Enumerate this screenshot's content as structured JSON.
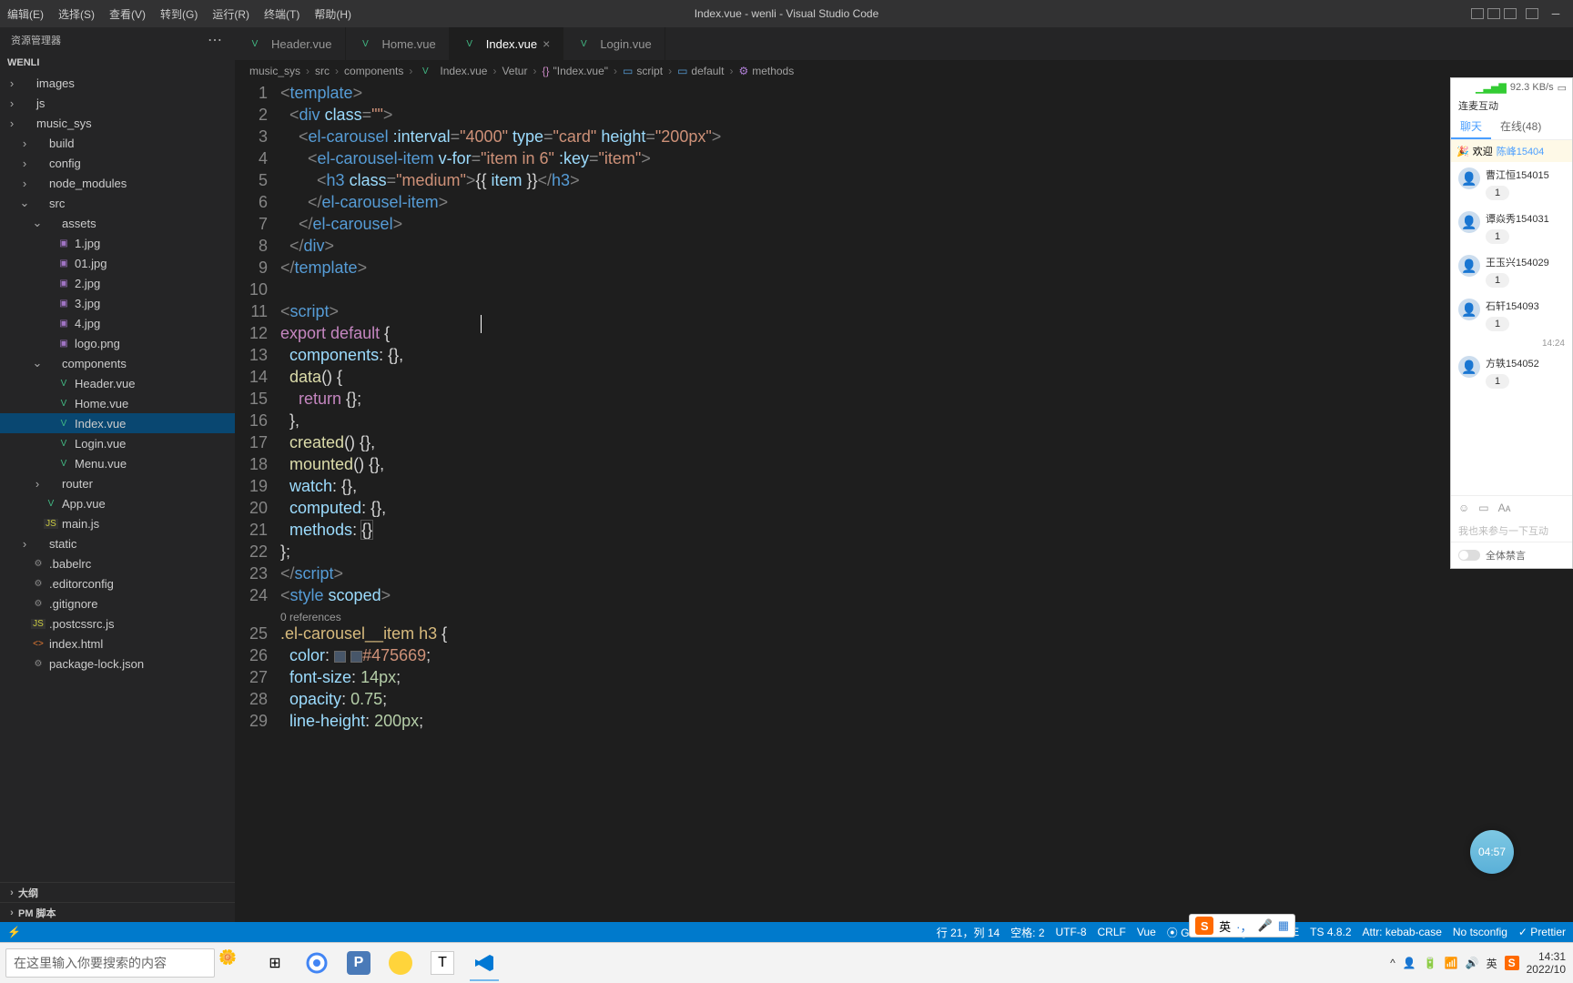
{
  "window_title": "Index.vue - wenli - Visual Studio Code",
  "menus": [
    "编辑(E)",
    "选择(S)",
    "查看(V)",
    "转到(G)",
    "运行(R)",
    "终端(T)",
    "帮助(H)"
  ],
  "explorer": {
    "header": "资源管理器",
    "project": "WENLI",
    "tree": [
      {
        "label": "images",
        "type": "folder",
        "chev": ">",
        "depth": 0
      },
      {
        "label": "js",
        "type": "folder",
        "chev": ">",
        "depth": 0
      },
      {
        "label": "music_sys",
        "type": "folder",
        "chev": ">",
        "depth": 0
      },
      {
        "label": "build",
        "type": "folder",
        "chev": ">",
        "depth": 1
      },
      {
        "label": "config",
        "type": "folder",
        "chev": ">",
        "depth": 1
      },
      {
        "label": "node_modules",
        "type": "folder",
        "chev": ">",
        "depth": 1
      },
      {
        "label": "src",
        "type": "folder",
        "chev": "v",
        "depth": 1
      },
      {
        "label": "assets",
        "type": "folder",
        "chev": "v",
        "depth": 2
      },
      {
        "label": "1.jpg",
        "type": "img",
        "depth": 3
      },
      {
        "label": "01.jpg",
        "type": "img",
        "depth": 3
      },
      {
        "label": "2.jpg",
        "type": "img",
        "depth": 3
      },
      {
        "label": "3.jpg",
        "type": "img",
        "depth": 3
      },
      {
        "label": "4.jpg",
        "type": "img",
        "depth": 3
      },
      {
        "label": "logo.png",
        "type": "img",
        "depth": 3
      },
      {
        "label": "components",
        "type": "folder",
        "chev": "v",
        "depth": 2
      },
      {
        "label": "Header.vue",
        "type": "vue",
        "depth": 3
      },
      {
        "label": "Home.vue",
        "type": "vue",
        "depth": 3
      },
      {
        "label": "Index.vue",
        "type": "vue",
        "depth": 3,
        "selected": true
      },
      {
        "label": "Login.vue",
        "type": "vue",
        "depth": 3
      },
      {
        "label": "Menu.vue",
        "type": "vue",
        "depth": 3
      },
      {
        "label": "router",
        "type": "folder",
        "chev": ">",
        "depth": 2
      },
      {
        "label": "App.vue",
        "type": "vue",
        "depth": 2
      },
      {
        "label": "main.js",
        "type": "js",
        "depth": 2
      },
      {
        "label": "static",
        "type": "folder",
        "chev": ">",
        "depth": 1
      },
      {
        "label": ".babelrc",
        "type": "generic",
        "depth": 1
      },
      {
        "label": ".editorconfig",
        "type": "generic",
        "depth": 1
      },
      {
        "label": ".gitignore",
        "type": "generic",
        "depth": 1
      },
      {
        "label": ".postcssrc.js",
        "type": "js",
        "depth": 1
      },
      {
        "label": "index.html",
        "type": "html",
        "depth": 1
      },
      {
        "label": "package-lock.json",
        "type": "generic",
        "depth": 1
      }
    ],
    "bottom_sections": [
      "大纲",
      "PM 脚本"
    ]
  },
  "tabs": [
    {
      "label": "Header.vue"
    },
    {
      "label": "Home.vue"
    },
    {
      "label": "Index.vue",
      "active": true,
      "close": true
    },
    {
      "label": "Login.vue"
    }
  ],
  "breadcrumbs": [
    "music_sys",
    "src",
    "components",
    "Index.vue",
    "Vetur",
    "\"Index.vue\"",
    "script",
    "default",
    "methods"
  ],
  "code": {
    "ref_lens": "0 references",
    "color_hex": "#475669",
    "lines_count": 29,
    "cursor": {
      "line": 21,
      "col": 14
    }
  },
  "statusbar": {
    "left": [
      "⚡"
    ],
    "right": [
      "行 21，列 14",
      "空格: 2",
      "UTF-8",
      "CRLF",
      "Vue",
      "⦿ Go Live",
      "Tag: UNSURE",
      "TS 4.8.2",
      "Attr: kebab-case",
      "No tsconfig",
      "✓ Prettier"
    ]
  },
  "chat": {
    "speed": "92.3 KB/s",
    "header": "连麦互动",
    "tabs": [
      {
        "label": "聊天",
        "active": true
      },
      {
        "label": "在线(48)"
      }
    ],
    "welcome_prefix": "欢迎",
    "welcome_link": "陈峰15404",
    "items": [
      {
        "name": "曹江恒154015",
        "msg": "1"
      },
      {
        "name": "谭焱秀154031",
        "msg": "1"
      },
      {
        "name": "王玉兴154029",
        "msg": "1"
      },
      {
        "name": "石轩154093",
        "msg": "1"
      }
    ],
    "time": "14:24",
    "items2": [
      {
        "name": "方轶154052",
        "msg": "1"
      }
    ],
    "placeholder": "我也来参与一下互动",
    "mute": "全体禁言"
  },
  "timer": "04:57",
  "ime": {
    "label": "英"
  },
  "taskbar": {
    "search_placeholder": "在这里输入你要搜索的内容",
    "clock_time": "14:31",
    "clock_date": "2022/10"
  }
}
